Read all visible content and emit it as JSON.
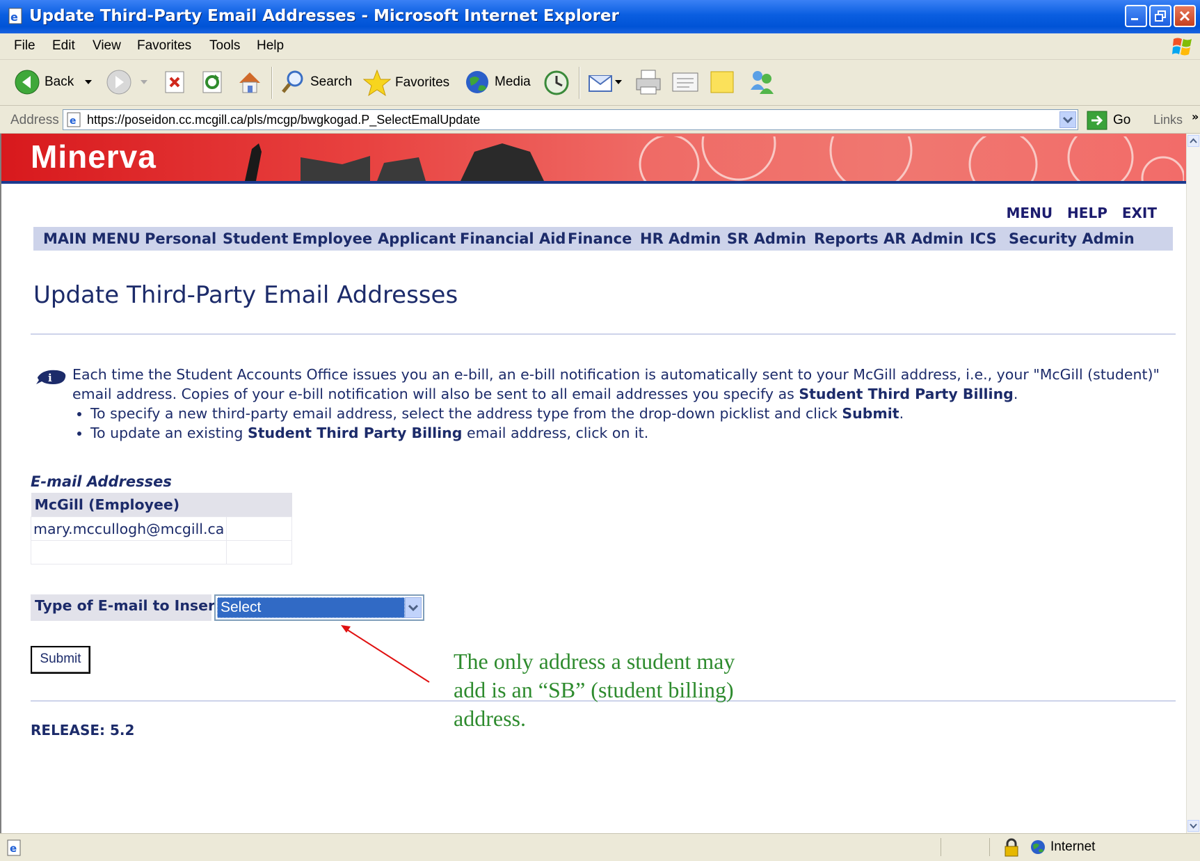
{
  "window": {
    "title": "Update Third-Party Email Addresses - Microsoft Internet Explorer"
  },
  "menu": [
    "File",
    "Edit",
    "View",
    "Favorites",
    "Tools",
    "Help"
  ],
  "toolbar": {
    "back": "Back",
    "search": "Search",
    "favorites": "Favorites",
    "media": "Media"
  },
  "address": {
    "label": "Address",
    "url": "https://poseidon.cc.mcgill.ca/pls/mcgp/bwgkogad.P_SelectEmalUpdate",
    "go": "Go",
    "links": "Links"
  },
  "banner": {
    "logo": "Minerva"
  },
  "toplinks": [
    "MENU",
    "HELP",
    "EXIT"
  ],
  "nav": [
    "MAIN MENU",
    "Personal",
    "Student",
    "Employee",
    "Applicant",
    "Financial Aid",
    "Finance",
    "HR Admin",
    "SR Admin",
    "Reports",
    "AR Admin",
    "ICS",
    "Security Admin"
  ],
  "page": {
    "title": "Update Third-Party Email Addresses",
    "info": {
      "p1": "Each time the Student Accounts Office issues you an e-bill, an e-bill notification is automatically sent to your McGill address, i.e., your \"McGill (student)\" email address. Copies of your e-bill notification will also be sent to all email addresses you specify as ",
      "p1_bold": "Student Third Party Billing",
      "p1_end": ".",
      "li1": "To specify a new third-party email address, select the address type from the drop-down picklist and click ",
      "li1_bold": "Submit",
      "li1_end": ".",
      "li2_start": "To update an existing ",
      "li2_bold": "Student Third Party Billing",
      "li2_end": " email address, click on it."
    },
    "section_label": "E-mail Addresses",
    "table": {
      "header": "McGill (Employee)",
      "email": "mary.mccullogh@mcgill.ca"
    },
    "insert_label": "Type of E-mail to Insert:",
    "select_value": "Select",
    "submit": "Submit",
    "release": "RELEASE: 5.2"
  },
  "annotation": "The only address a student may add is an “SB” (student billing) address.",
  "status": {
    "zone": "Internet"
  },
  "colors": {
    "nav_bg": "#cdd3ea",
    "text": "#1c2b6a",
    "annotation": "#2e8b2e"
  }
}
